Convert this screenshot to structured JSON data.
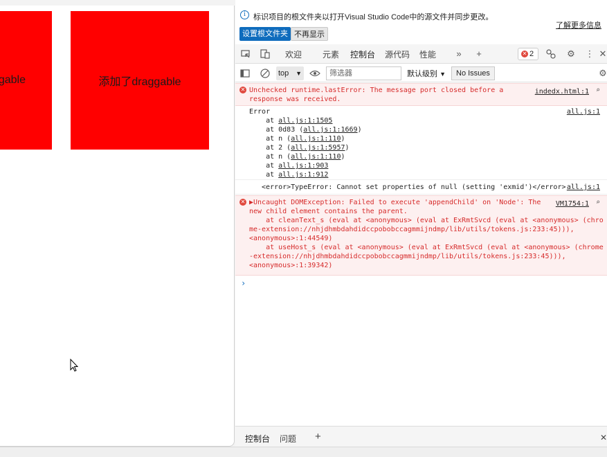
{
  "page": {
    "box_left_label": "gable",
    "box_right_label": "添加了draggable",
    "box_color": "#ff0000"
  },
  "infobar": {
    "message": "标识项目的根文件夹以打开Visual Studio Code中的源文件并同步更改。",
    "learn_more": "了解更多信息",
    "set_root_button": "设置根文件夹",
    "dont_show_button": "不再显示"
  },
  "tabs": {
    "welcome": "欢迎",
    "elements": "元素",
    "console": "控制台",
    "sources": "源代码",
    "performance": "性能",
    "error_count": "2"
  },
  "filterbar": {
    "context": "top",
    "filter_placeholder": "筛选器",
    "levels": "默认级别",
    "issues": "No Issues"
  },
  "console": {
    "messages": [
      {
        "text": "Unchecked runtime.lastError: The message port closed before a\nresponse was received.",
        "source": "indedx.html:1"
      },
      {
        "source": "all.js:1",
        "lines": [
          {
            "pre": "Error",
            "link": "",
            "post": ""
          },
          {
            "pre": "    at ",
            "link": "all.js:1:1505",
            "post": ""
          },
          {
            "pre": "    at 0d83 (",
            "link": "all.js:1:1669",
            "post": ")"
          },
          {
            "pre": "    at n (",
            "link": "all.js:1:110",
            "post": ")"
          },
          {
            "pre": "    at 2 (",
            "link": "all.js:1:5957",
            "post": ")"
          },
          {
            "pre": "    at n (",
            "link": "all.js:1:110",
            "post": ")"
          },
          {
            "pre": "    at ",
            "link": "all.js:1:903",
            "post": ""
          },
          {
            "pre": "    at ",
            "link": "all.js:1:912",
            "post": ""
          }
        ]
      },
      {
        "text": "<error>TypeError: Cannot set properties of null (setting 'exmid')</error>",
        "source": "all.js:1"
      },
      {
        "text": "▶Uncaught DOMException: Failed to execute 'appendChild' on 'Node': The\nnew child element contains the parent.\n    at cleanText_s (eval at <anonymous> (eval at ExRmtSvcd (eval at <anonymous> (chro\nme-extension://nhjdhmbdahdidccpobobccagmmijndmp/lib/utils/tokens.js:233:45))),\n<anonymous>:1:44549)\n    at useHost_s (eval at <anonymous> (eval at ExRmtSvcd (eval at <anonymous> (chrome\n-extension://nhjdhmbdahdidccpobobccagmmijndmp/lib/utils/tokens.js:233:45))),\n<anonymous>:1:39342)",
        "source": "VM1754:1"
      }
    ]
  },
  "drawer": {
    "console_tab": "控制台",
    "issues_tab": "问题"
  }
}
